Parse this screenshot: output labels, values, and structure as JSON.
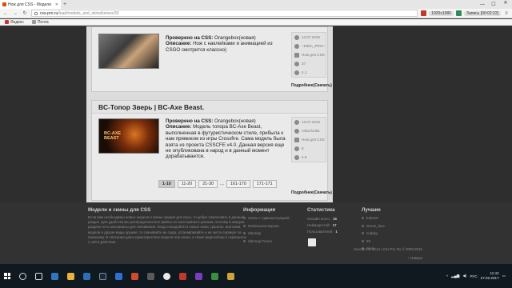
{
  "browser": {
    "tab_title": "Нож для CSS - Модели",
    "tab_close": "✕",
    "new_tab": "+",
    "address_host": "css-pro.ru",
    "address_path": "/load/models_and_skins/knives/33",
    "ext_label": "1920x1080",
    "ext_label2": "Запись [00:02:22]",
    "minimize": "—",
    "maximize": "☐",
    "close": "✕",
    "bookmarks": [
      {
        "label": "Яндекс",
        "icon": "yandex-icon"
      },
      {
        "label": "Почта",
        "icon": "mail-icon"
      }
    ]
  },
  "cards": [
    {
      "title": "",
      "line1_label": "Проверено на CSS:",
      "line1_value": " Orangebox(новая)",
      "desc_label": "Описание:",
      "desc_text": " Нож с наклейками и анимацией из CSGO смотрится классно)",
      "date": "13.07.2015",
      "author": "~K89A_PRO~",
      "category": "Нож для CSS",
      "views": "37",
      "rating": "4.1",
      "more": "Подробнее(Скачать)"
    },
    {
      "title": "BC-Топор Зверь | BC-Axe Beast.",
      "line1_label": "Проверено на CSS:",
      "line1_value": " Orangebox(новая)",
      "desc_label": "Описание:",
      "desc_text": " Модель топора BC-Axe Beast, выполненная в футуристическом стиле, прибыла к нам прямиком из игры Crossfire. Сама модель была взята из проекта CSSCFE v4.0. Данная версия еще не опубликована в народ и в данный момент дорабатывается.",
      "thumb_text": "BC-AXE BEAST",
      "date": "13.07.2015",
      "author": "Askurl1451",
      "category": "Нож для CSS",
      "views": "6",
      "rating": "4.6",
      "more": "Подробнее(Скачать)"
    }
  ],
  "pagination": {
    "pages": [
      "1-10",
      "11-20",
      "21-30",
      "161-170",
      "171-171"
    ],
    "dots": "...",
    "active": "1-10"
  },
  "footer": {
    "col1_title": "Модели и скины для CSS",
    "col1_text": "Если вам необходимы новые модели и скины оружия для игры, то добро пожаловать в данный раздел. Для удобства мы распределили все файлы по категориям и разным, поэтому в каждом разделе есть материалы для скачивания. Когда понадобятся новые ножи, гранаты, винтовки, модели и другие виды оружия, то скачивайте их сюда, устанавливайте и на экспо-сервере по-прежнему. В описании дана характеристика модели или скина, а также видеообзор и скриншоты с ней в действии",
    "col2_title": "Информация",
    "col2_items": [
      "Связь с Администрацией",
      "Мобильная версия",
      "Sitemap",
      "Sitemap Forum"
    ],
    "col3_title": "Статистика",
    "stats": [
      {
        "label": "Онлайн всего:",
        "value": "16"
      },
      {
        "label": "Неймодостей:",
        "value": "17"
      },
      {
        "label": "Пользователей:",
        "value": "1"
      }
    ],
    "col4_title": "Лучшие",
    "col4_items": [
      "bob416",
      "Green_face",
      "noddyy",
      "88",
      "alexa"
    ],
    "copyright": "Контакт от uCoz | Css Pro Ru © 2009-2015",
    "top_link": "↑ Наверх"
  },
  "taskbar": {
    "lang": "РУС",
    "time": "11:42",
    "date": "27.02.2017"
  }
}
